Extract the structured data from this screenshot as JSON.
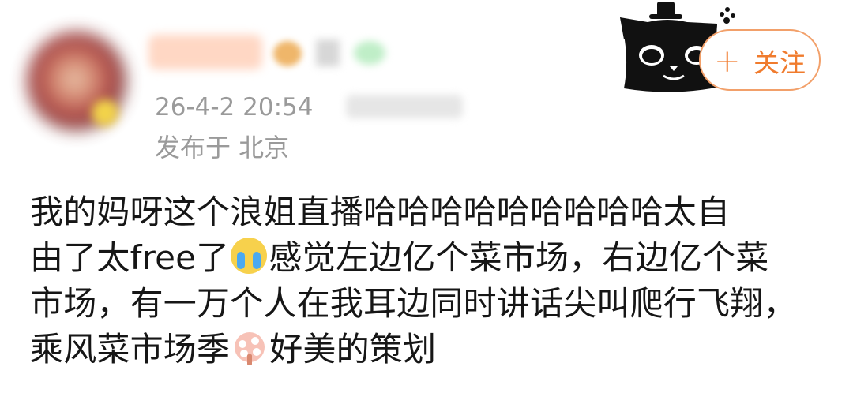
{
  "header": {
    "timestamp": "26-4-2 20:54",
    "location": "发布于 北京",
    "follow_label": "关注",
    "follow_plus": "+"
  },
  "post": {
    "line1": "我的妈呀这个浪姐直播哈哈哈哈哈哈哈哈哈太自",
    "line2_before": "由了太free了",
    "line2_after": "感觉左边亿个菜市场，右边亿个菜",
    "line3": "市场，有一万个人在我耳边同时讲话尖叫爬行飞翔，",
    "line4_before": "乘风菜市场季",
    "line4_after": "好美的策划"
  },
  "icons": {
    "cat": "cat-decoration-icon",
    "cry": "crying-face-icon",
    "fan": "fan-blossom-icon"
  },
  "colors": {
    "accent": "#f07b2d",
    "follow_border": "#f2a06a",
    "meta": "#9a9a9a",
    "text": "#161616"
  }
}
